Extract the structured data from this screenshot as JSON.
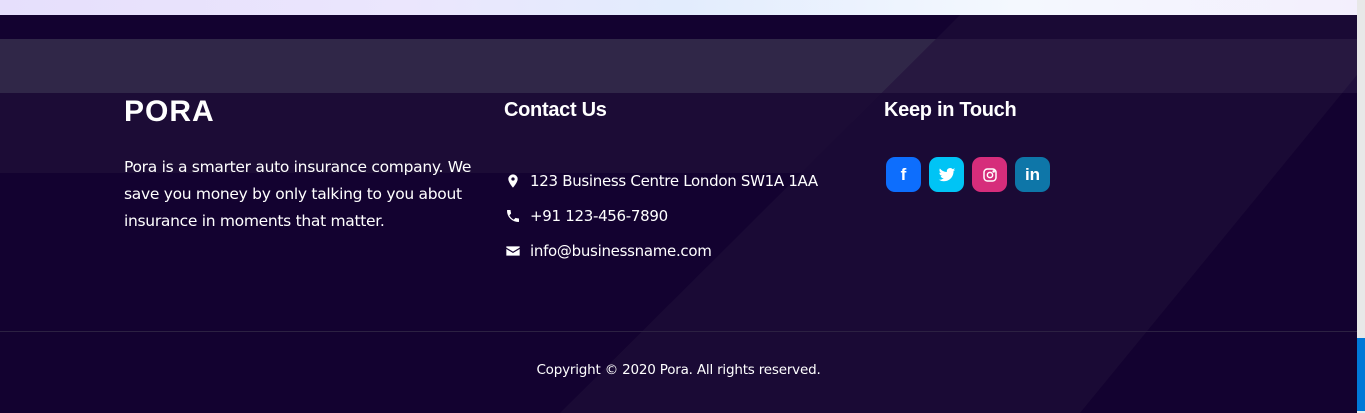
{
  "brand": {
    "logo": "PORA",
    "description": "Pora is a smarter auto insurance company. We save you money by only talking to you about insurance in moments that matter."
  },
  "contact": {
    "title": "Contact Us",
    "address": "123 Business Centre London SW1A 1AA",
    "phone": "+91 123-456-7890",
    "email": "info@businessname.com"
  },
  "social": {
    "title": "Keep in Touch",
    "items": [
      {
        "name": "facebook",
        "glyph": "f",
        "color": "#0d6efd"
      },
      {
        "name": "twitter",
        "glyph": "",
        "color": "#00c4f5"
      },
      {
        "name": "instagram",
        "glyph": "",
        "color": "#d62d7b"
      },
      {
        "name": "linkedin",
        "glyph": "in",
        "color": "#0e76a8"
      }
    ]
  },
  "copyright": "Copyright © 2020 Pora. All rights reserved."
}
